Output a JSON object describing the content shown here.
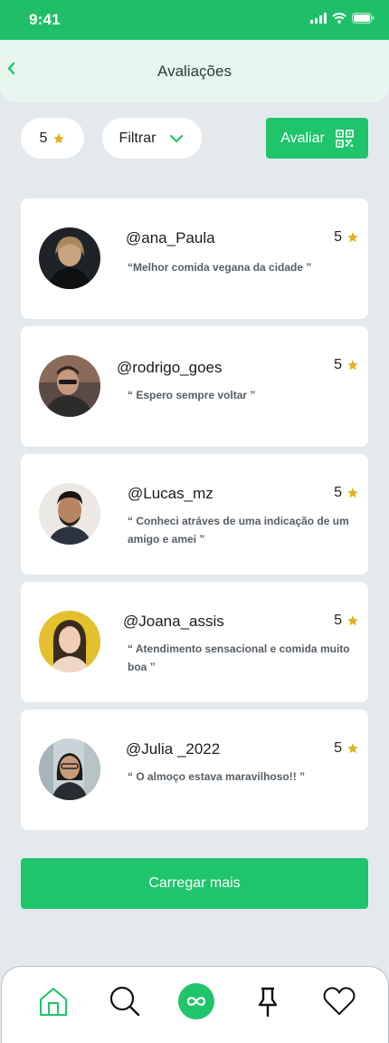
{
  "status_bar": {
    "time": "9:41"
  },
  "header": {
    "title": "Avaliações"
  },
  "toolbar": {
    "rating_value": "5",
    "filter_label": "Filtrar",
    "rate_button_label": "Avaliar"
  },
  "reviews": [
    {
      "username": "@ana_Paula",
      "rating": "5",
      "comment": "“Melhor comida vegana da cidade ”"
    },
    {
      "username": "@rodrigo_goes",
      "rating": "5",
      "comment": "“ Espero sempre voltar ”"
    },
    {
      "username": "@Lucas_mz",
      "rating": "5",
      "comment": "“ Conheci atráves de uma indicação de um amigo e amei ”"
    },
    {
      "username": "@Joana_assis",
      "rating": "5",
      "comment": "“ Atendimento sensacional e comida muito boa ”"
    },
    {
      "username": "@Julia _2022",
      "rating": "5",
      "comment": "“ O almoço estava maravilhoso!! ”"
    }
  ],
  "load_more_label": "Carregar mais",
  "bottom_nav": {
    "items": [
      "home-icon",
      "search-icon",
      "infinity-icon",
      "pin-icon",
      "heart-icon"
    ]
  },
  "colors": {
    "primary": "#1fc46b",
    "header_bg": "#e7f6ee",
    "page_bg": "#e4e9ee",
    "star": "#e0b325"
  }
}
